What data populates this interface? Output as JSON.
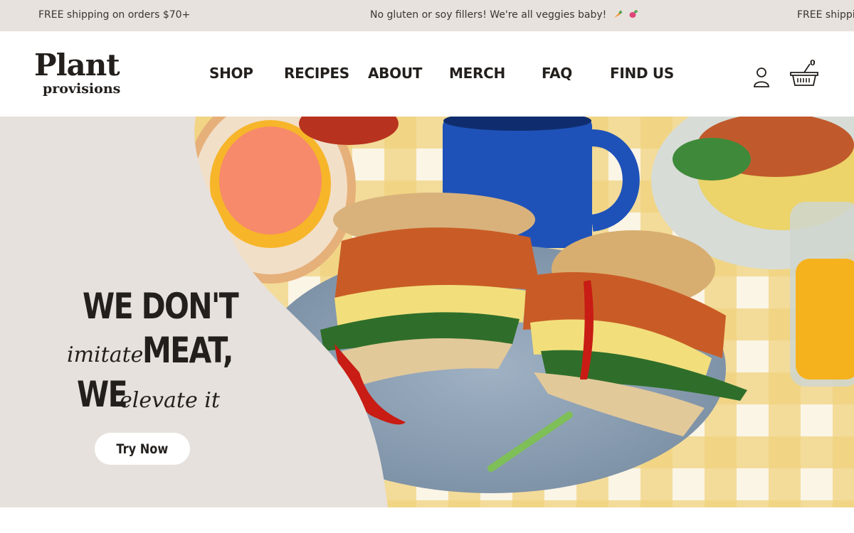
{
  "announcement": {
    "messages": [
      "FREE shipping on orders $70+",
      "No gluten or soy fillers! We're all veggies baby!",
      "FREE shippi"
    ]
  },
  "brand": {
    "line1": "Plant",
    "line2": "provisions"
  },
  "nav": {
    "items": [
      "SHOP",
      "RECIPES",
      "ABOUT",
      "MERCH",
      "FAQ",
      "FIND US"
    ]
  },
  "header_icons": {
    "account": "user-icon",
    "cart": "basket-icon",
    "cart_count": "0"
  },
  "hero": {
    "line1": "WE DON'T",
    "line2_script": "imitate",
    "line2_bold": "MEAT,",
    "line3_bold": "WE",
    "line3_script": "elevate it",
    "cta_label": "Try Now",
    "image": "vegan-bagel-sandwich-photo"
  },
  "colors": {
    "announcement_bg": "#e7e2dd",
    "hero_panel_bg": "#e6e1dc",
    "text_dark": "#231f1c",
    "button_bg": "#ffffff"
  }
}
